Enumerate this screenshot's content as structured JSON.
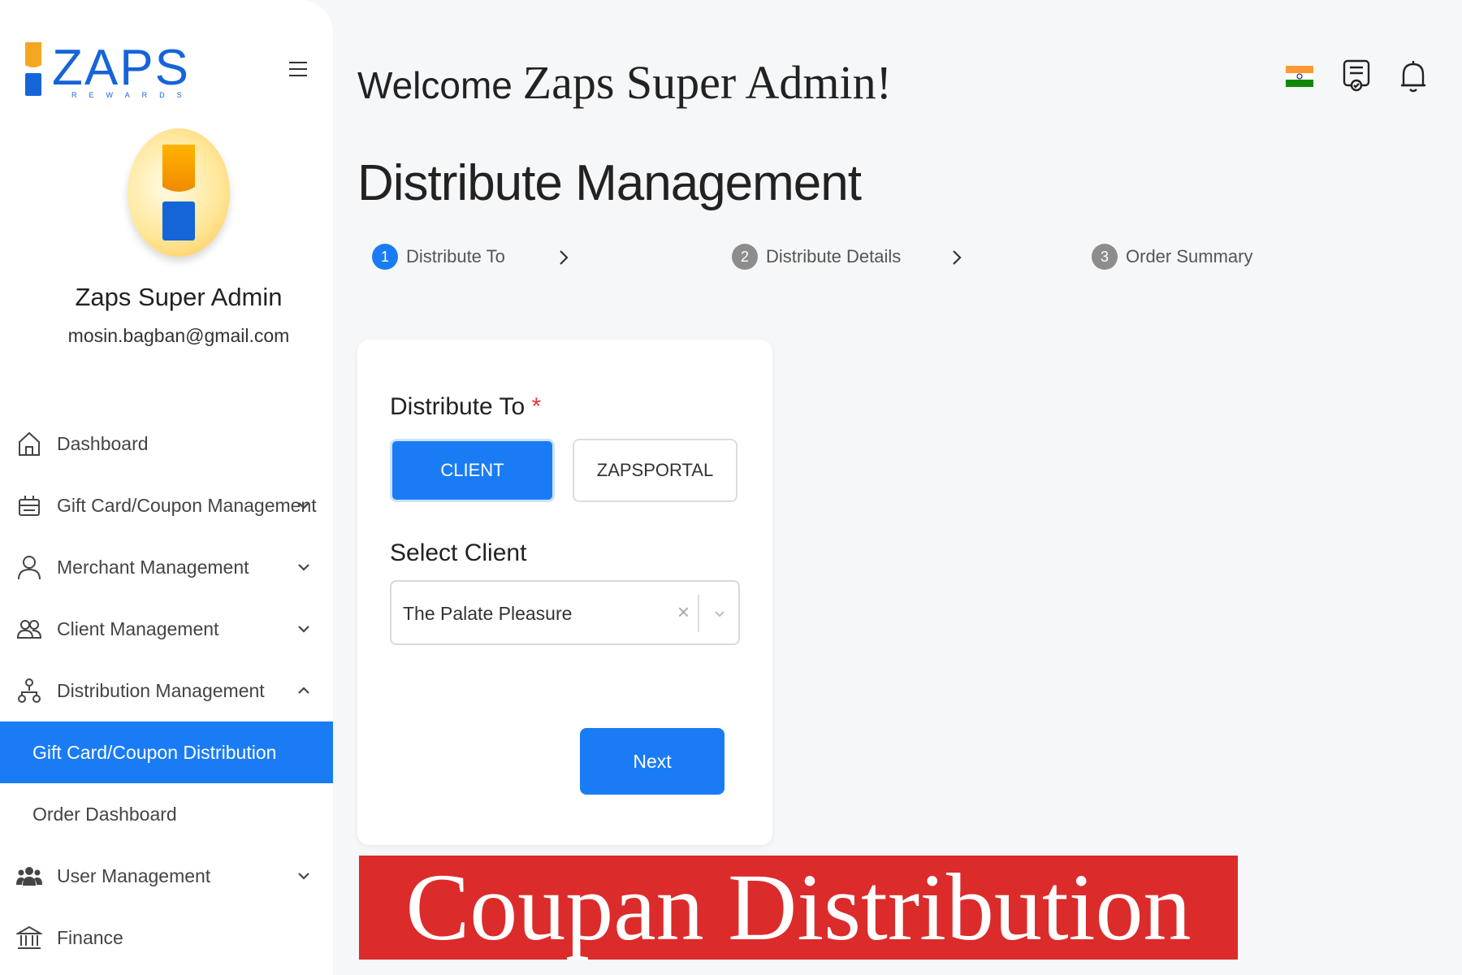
{
  "brand": {
    "logo_text": "ZAPS",
    "logo_sub": "REWARDS"
  },
  "profile": {
    "name": "Zaps Super Admin",
    "email": "mosin.bagban@gmail.com"
  },
  "sidebar": {
    "items": [
      {
        "label": "Dashboard",
        "icon": "home-icon"
      },
      {
        "label": "Gift Card/Coupon Management",
        "icon": "gift-card-icon"
      },
      {
        "label": "Merchant Management",
        "icon": "merchant-icon"
      },
      {
        "label": "Client Management",
        "icon": "clients-icon"
      },
      {
        "label": "Distribution Management",
        "icon": "distribution-icon"
      },
      {
        "label": "User Management",
        "icon": "users-icon"
      },
      {
        "label": "Finance",
        "icon": "bank-icon"
      }
    ],
    "sub_items": [
      {
        "label": "Gift Card/Coupon Distribution",
        "active": true
      },
      {
        "label": "Order Dashboard",
        "active": false
      }
    ]
  },
  "header": {
    "welcome_prefix": "Welcome",
    "welcome_name": "Zaps Super Admin!"
  },
  "page": {
    "title": "Distribute Management"
  },
  "steps": [
    {
      "num": "1",
      "label": "Distribute To",
      "active": true
    },
    {
      "num": "2",
      "label": "Distribute Details",
      "active": false
    },
    {
      "num": "3",
      "label": "Order Summary",
      "active": false
    }
  ],
  "form": {
    "distribute_label": "Distribute To",
    "required_mark": "*",
    "options": [
      "CLIENT",
      "ZAPSPORTAL"
    ],
    "selected_option": "CLIENT",
    "select_client_label": "Select Client",
    "select_client_value": "The Palate Pleasure",
    "clear_symbol": "×",
    "next_label": "Next"
  },
  "banner": {
    "text": "Coupan Distribution"
  },
  "colors": {
    "primary": "#1a7cf5",
    "banner": "#dc2b2b",
    "inactive_step": "#8d8d8d"
  }
}
